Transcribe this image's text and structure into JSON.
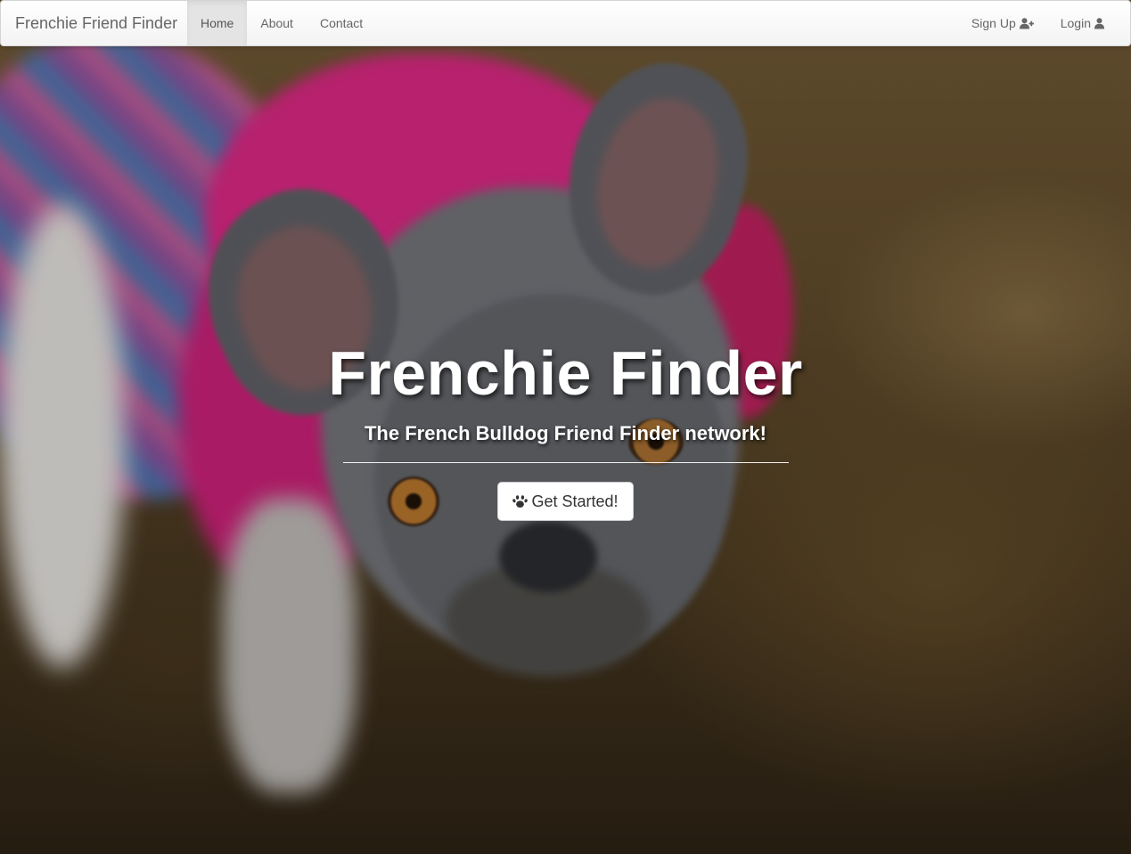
{
  "navbar": {
    "brand": "Frenchie Friend Finder",
    "left_items": [
      {
        "label": "Home",
        "active": true
      },
      {
        "label": "About",
        "active": false
      },
      {
        "label": "Contact",
        "active": false
      }
    ],
    "right_items": [
      {
        "label": "Sign Up",
        "icon": "user-plus-icon"
      },
      {
        "label": "Login",
        "icon": "user-icon"
      }
    ]
  },
  "hero": {
    "title": "Frenchie Finder",
    "subtitle": "The French Bulldog Friend Finder network!",
    "cta_label": "Get Started!",
    "cta_icon": "paw-icon",
    "background_image": "blurred photo of a grey French bulldog wearing a pink coat"
  },
  "colors": {
    "navbar_bg": "#f8f8f8",
    "nav_text": "#666666",
    "nav_active_bg": "#e4e4e4",
    "hero_text": "#ffffff",
    "button_bg": "#ffffff",
    "button_text": "#333333"
  }
}
